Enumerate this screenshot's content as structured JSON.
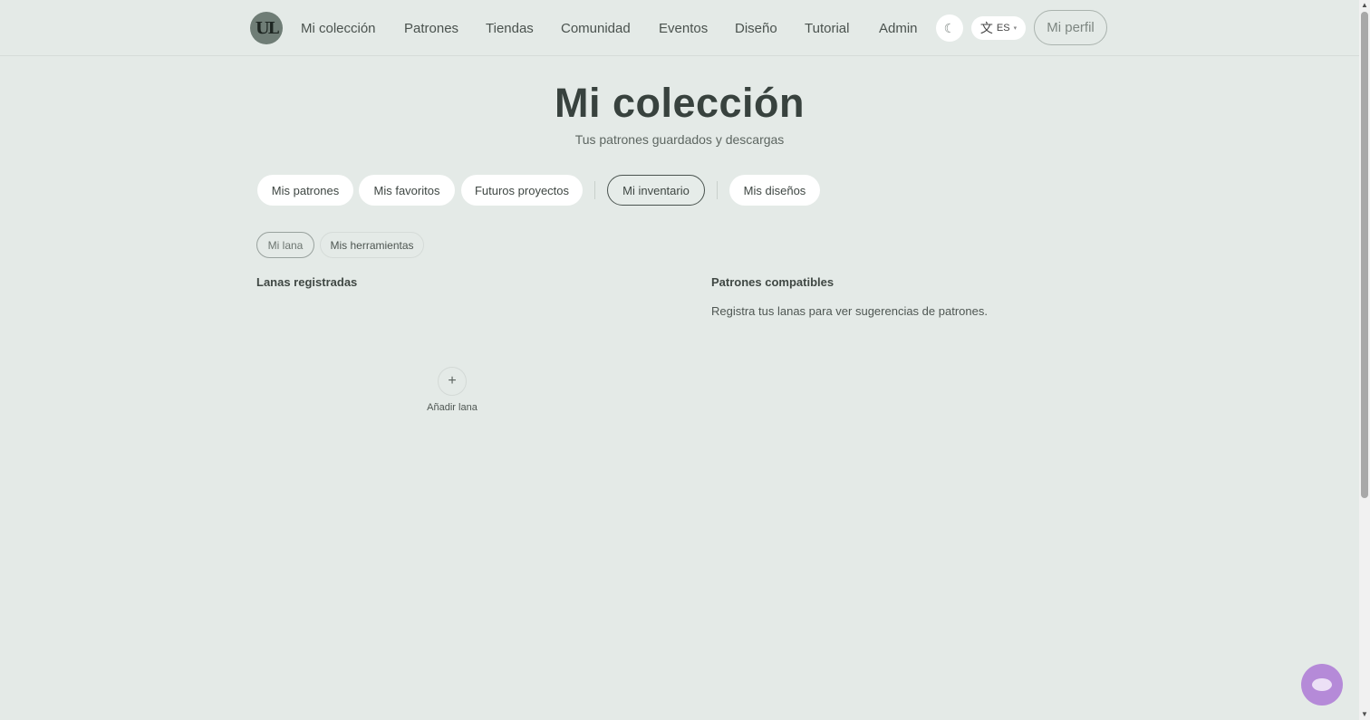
{
  "brand": {
    "logo_text": "UL"
  },
  "nav": {
    "items": [
      {
        "label": "Mi colección"
      },
      {
        "label": "Patrones"
      },
      {
        "label": "Tiendas"
      },
      {
        "label": "Comunidad"
      },
      {
        "label": "Eventos"
      },
      {
        "label": "Diseño"
      },
      {
        "label": "Tutorial"
      },
      {
        "label": "Admin"
      }
    ],
    "theme_icon": "☾",
    "lang_glyph": "文",
    "lang_code": "ES",
    "lang_caret": "▾",
    "profile_label": "Mi perfil"
  },
  "page": {
    "title": "Mi colección",
    "subtitle": "Tus patrones guardados y descargas"
  },
  "tabs": [
    {
      "label": "Mis patrones"
    },
    {
      "label": "Mis favoritos"
    },
    {
      "label": "Futuros proyectos"
    },
    {
      "label": "Mi inventario",
      "active": true
    },
    {
      "label": "Mis diseños"
    }
  ],
  "subtabs": [
    {
      "label": "Mi lana",
      "active": true
    },
    {
      "label": "Mis herramientas"
    }
  ],
  "yarns": {
    "heading": "Lanas registradas",
    "add_icon": "+",
    "add_label": "Añadir lana"
  },
  "compatible": {
    "heading": "Patrones compatibles",
    "empty_text": "Registra tus lanas para ver sugerencias de patrones."
  },
  "chat": {
    "icon": "chat-bubble-icon"
  },
  "colors": {
    "background": "#e4eae7",
    "chat_accent": "#b58ad8"
  }
}
